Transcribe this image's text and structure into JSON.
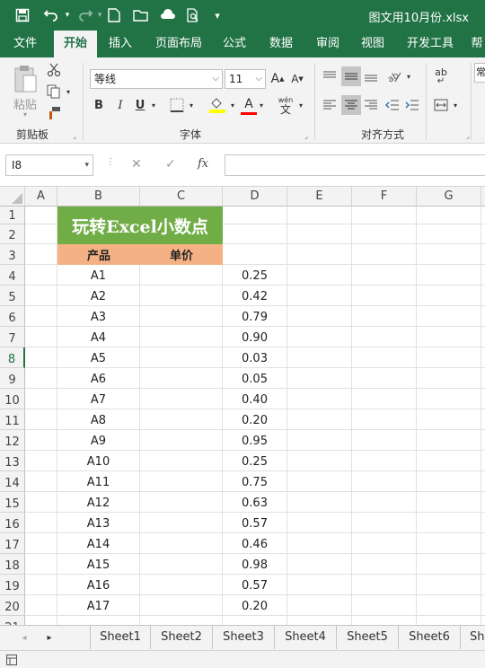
{
  "title_bar": {
    "filename": "图文用10月份.xlsx"
  },
  "tabs": [
    "文件",
    "开始",
    "插入",
    "页面布局",
    "公式",
    "数据",
    "审阅",
    "视图",
    "开发工具",
    "帮"
  ],
  "ribbon": {
    "clipboard": {
      "paste": "粘贴",
      "label": "剪贴板"
    },
    "font": {
      "name": "等线",
      "size": "11",
      "label": "字体",
      "bold": "B",
      "italic": "I",
      "underline": "U",
      "grow": "A",
      "shrink": "A",
      "wen": "wén",
      "wen_char": "文"
    },
    "alignment": {
      "label": "对齐方式"
    },
    "overflow": "常"
  },
  "formula_bar": {
    "name_box": "I8",
    "fx": "fx",
    "value": ""
  },
  "columns": [
    "A",
    "B",
    "C",
    "D",
    "E",
    "F",
    "G"
  ],
  "sheet": {
    "title": "玩转Excel小数点",
    "header_product": "产品",
    "header_price": "单价",
    "rows": [
      {
        "row": "4",
        "product": "A1",
        "value": "0.25"
      },
      {
        "row": "5",
        "product": "A2",
        "value": "0.42"
      },
      {
        "row": "6",
        "product": "A3",
        "value": "0.79"
      },
      {
        "row": "7",
        "product": "A4",
        "value": "0.90"
      },
      {
        "row": "8",
        "product": "A5",
        "value": "0.03"
      },
      {
        "row": "9",
        "product": "A6",
        "value": "0.05"
      },
      {
        "row": "10",
        "product": "A7",
        "value": "0.40"
      },
      {
        "row": "11",
        "product": "A8",
        "value": "0.20"
      },
      {
        "row": "12",
        "product": "A9",
        "value": "0.95"
      },
      {
        "row": "13",
        "product": "A10",
        "value": "0.25"
      },
      {
        "row": "14",
        "product": "A11",
        "value": "0.75"
      },
      {
        "row": "15",
        "product": "A12",
        "value": "0.63"
      },
      {
        "row": "16",
        "product": "A13",
        "value": "0.57"
      },
      {
        "row": "17",
        "product": "A14",
        "value": "0.46"
      },
      {
        "row": "18",
        "product": "A15",
        "value": "0.98"
      },
      {
        "row": "19",
        "product": "A16",
        "value": "0.57"
      },
      {
        "row": "20",
        "product": "A17",
        "value": "0.20"
      }
    ],
    "row_labels_top": [
      "1",
      "2",
      "3"
    ],
    "row_21": "21"
  },
  "sheet_tabs": [
    "Sheet1",
    "Sheet2",
    "Sheet3",
    "Sheet4",
    "Sheet5",
    "Sheet6",
    "Sh"
  ],
  "colors": {
    "excel_green": "#217346",
    "title_fill": "#70ad47",
    "header_fill": "#f4b183"
  }
}
